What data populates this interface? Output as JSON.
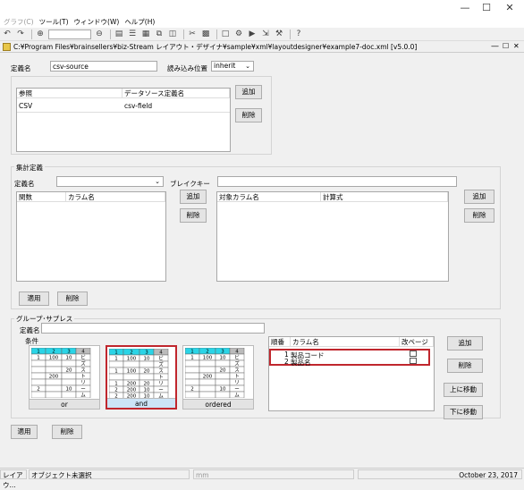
{
  "menu": [
    "グラフ(C)",
    "ツール(T)",
    "ウィンドウ(W)",
    "ヘルプ(H)"
  ],
  "doc_title": "C:¥Program Files¥brainsellers¥biz-Stream レイアウト・デザイナ¥sample¥xml¥layoutdesigner¥example7-doc.xml [v5.0.0]",
  "definition": {
    "name_label": "定義名",
    "name_value": "csv-source",
    "position_label": "読み込み位置",
    "position_value": "inherit"
  },
  "ref_table": {
    "columns": [
      "参照",
      "データソース定義名"
    ],
    "rows": [
      [
        "CSV",
        "csv-field"
      ]
    ],
    "add": "追加",
    "remove": "削除"
  },
  "aggregate": {
    "title": "集計定義",
    "name_label": "定義名",
    "break_label": "ブレイクキー",
    "left_columns": [
      "関数",
      "カラム名"
    ],
    "right_columns": [
      "対象カラム名",
      "計算式"
    ],
    "add": "追加",
    "remove": "削除",
    "apply": "適用",
    "delete": "削除"
  },
  "group": {
    "title": "グループ･サプレス",
    "name_label": "定義名",
    "condition_label": "条件",
    "thumbs": [
      "or",
      "and",
      "ordered"
    ],
    "columns": [
      "順番",
      "カラム名",
      "改ページ"
    ],
    "rows": [
      {
        "order": "1",
        "name": "製品コード"
      },
      {
        "order": "2",
        "name": "製品名"
      }
    ],
    "add": "追加",
    "remove": "削除",
    "up": "上に移動",
    "down": "下に移動"
  },
  "bottom": {
    "apply": "適用",
    "delete": "削除"
  },
  "status": {
    "left": "レイアウ...",
    "object": "オブジェクト未選択",
    "unit": "mm",
    "date": "October 23, 2017"
  },
  "mini_table": {
    "header": [
      "1",
      "2",
      "3",
      "4"
    ],
    "rows": [
      [
        "1",
        "100",
        "10",
        "ビ"
      ],
      [
        "",
        "",
        "",
        "ズ"
      ],
      [
        "",
        "",
        "20",
        "ス"
      ],
      [
        "",
        "200",
        "",
        "ト"
      ],
      [
        "",
        "",
        "",
        "リ"
      ],
      [
        "2",
        "",
        "10",
        "ー"
      ],
      [
        "",
        "",
        "",
        "ム"
      ]
    ],
    "rows_and": [
      [
        "1",
        "100",
        "10",
        "ビ"
      ],
      [
        "",
        "",
        "",
        "ズ"
      ],
      [
        "1",
        "100",
        "20",
        "ス"
      ],
      [
        "",
        "",
        "",
        "ト"
      ],
      [
        "1",
        "200",
        "20",
        "リ"
      ],
      [
        "2",
        "200",
        "10",
        "ー"
      ],
      [
        "2",
        "200",
        "10",
        "ム"
      ]
    ]
  },
  "colors": {
    "highlight": "#c0262d",
    "thumb_header": "#2ad4e6"
  }
}
